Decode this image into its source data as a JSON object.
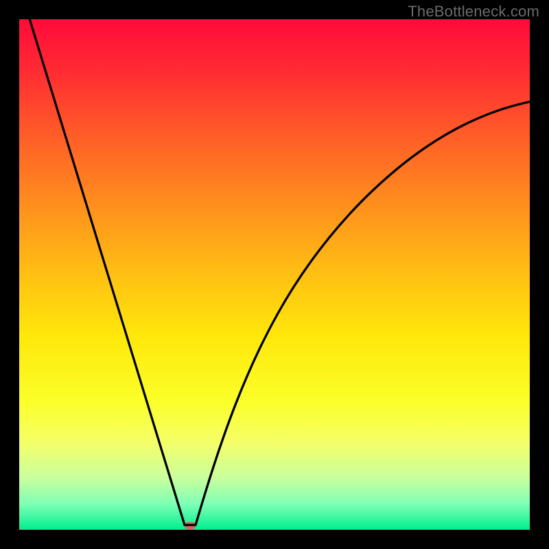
{
  "watermark": {
    "text": "TheBottleneck.com"
  },
  "chart_data": {
    "type": "line",
    "title": "",
    "xlabel": "",
    "ylabel": "",
    "xlim": [
      0,
      100
    ],
    "ylim": [
      0,
      100
    ],
    "grid": false,
    "legend": false,
    "background_gradient": {
      "direction": "vertical",
      "stops": [
        {
          "pos": 0.0,
          "color": "#ff0a3a"
        },
        {
          "pos": 0.5,
          "color": "#ffcc10"
        },
        {
          "pos": 0.8,
          "color": "#f8ff55"
        },
        {
          "pos": 1.0,
          "color": "#00ef8e"
        }
      ]
    },
    "series": [
      {
        "name": "left-branch",
        "x": [
          2,
          6,
          10,
          14,
          18,
          22,
          26,
          30,
          32.4
        ],
        "y": [
          100,
          87,
          74,
          61,
          48,
          35,
          22,
          9,
          1
        ]
      },
      {
        "name": "right-branch",
        "x": [
          34.6,
          38,
          42,
          46,
          52,
          58,
          64,
          72,
          80,
          88,
          96,
          100
        ],
        "y": [
          1,
          12,
          24,
          34,
          46,
          55,
          62,
          69,
          75,
          79,
          82,
          84
        ]
      }
    ],
    "marker": {
      "x": 33.5,
      "y": 0.8,
      "color": "#d7685f"
    }
  }
}
